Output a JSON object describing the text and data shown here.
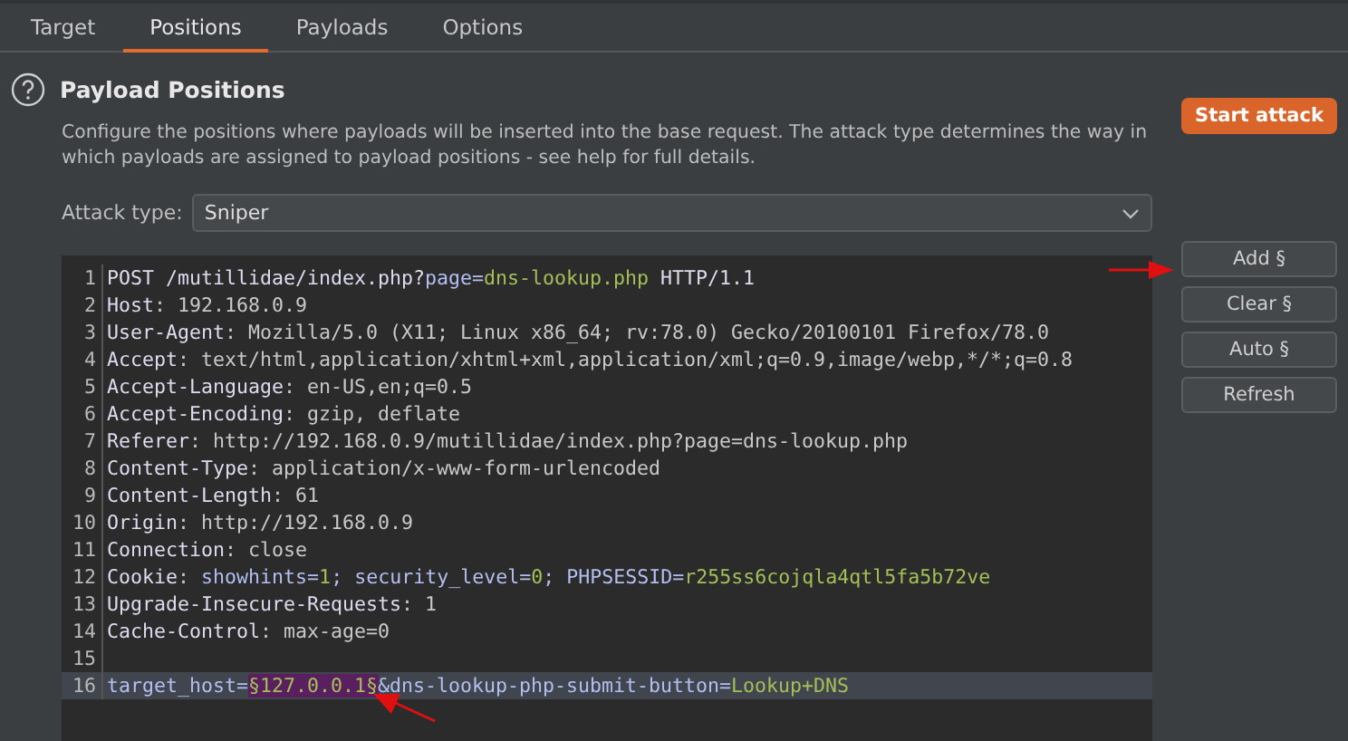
{
  "tabs": [
    {
      "label": "Target",
      "selected": false
    },
    {
      "label": "Positions",
      "selected": true
    },
    {
      "label": "Payloads",
      "selected": false
    },
    {
      "label": "Options",
      "selected": false
    }
  ],
  "section": {
    "title": "Payload Positions",
    "description": "Configure the positions where payloads will be inserted into the base request. The attack type determines the way in which payloads are assigned to payload positions - see help for full details.",
    "start_button": "Start attack"
  },
  "attack_type": {
    "label": "Attack type:",
    "value": "Sniper"
  },
  "editor": {
    "lines": [
      {
        "number": "1",
        "current": false,
        "segments": [
          {
            "kind": "name",
            "text": "POST /mutillidae/index.php?"
          },
          {
            "kind": "param",
            "text": "page="
          },
          {
            "kind": "value",
            "text": "dns-lookup.php"
          },
          {
            "kind": "name",
            "text": " HTTP/1.1"
          }
        ]
      },
      {
        "number": "2",
        "current": false,
        "segments": [
          {
            "kind": "name",
            "text": "Host"
          },
          {
            "kind": "text",
            "text": ": 192.168.0.9"
          }
        ]
      },
      {
        "number": "3",
        "current": false,
        "segments": [
          {
            "kind": "name",
            "text": "User-Agent"
          },
          {
            "kind": "text",
            "text": ": Mozilla/5.0 (X11; Linux x86_64; rv:78.0) Gecko/20100101 Firefox/78.0"
          }
        ]
      },
      {
        "number": "4",
        "current": false,
        "segments": [
          {
            "kind": "name",
            "text": "Accept"
          },
          {
            "kind": "text",
            "text": ": text/html,application/xhtml+xml,application/xml;q=0.9,image/webp,*/*;q=0.8"
          }
        ]
      },
      {
        "number": "5",
        "current": false,
        "segments": [
          {
            "kind": "name",
            "text": "Accept-Language"
          },
          {
            "kind": "text",
            "text": ": en-US,en;q=0.5"
          }
        ]
      },
      {
        "number": "6",
        "current": false,
        "segments": [
          {
            "kind": "name",
            "text": "Accept-Encoding"
          },
          {
            "kind": "text",
            "text": ": gzip, deflate"
          }
        ]
      },
      {
        "number": "7",
        "current": false,
        "segments": [
          {
            "kind": "name",
            "text": "Referer"
          },
          {
            "kind": "text",
            "text": ": http://192.168.0.9/mutillidae/index.php?page=dns-lookup.php"
          }
        ]
      },
      {
        "number": "8",
        "current": false,
        "segments": [
          {
            "kind": "name",
            "text": "Content-Type"
          },
          {
            "kind": "text",
            "text": ": application/x-www-form-urlencoded"
          }
        ]
      },
      {
        "number": "9",
        "current": false,
        "segments": [
          {
            "kind": "name",
            "text": "Content-Length"
          },
          {
            "kind": "text",
            "text": ": 61"
          }
        ]
      },
      {
        "number": "10",
        "current": false,
        "segments": [
          {
            "kind": "name",
            "text": "Origin"
          },
          {
            "kind": "text",
            "text": ": http://192.168.0.9"
          }
        ]
      },
      {
        "number": "11",
        "current": false,
        "segments": [
          {
            "kind": "name",
            "text": "Connection"
          },
          {
            "kind": "text",
            "text": ": close"
          }
        ]
      },
      {
        "number": "12",
        "current": false,
        "segments": [
          {
            "kind": "name",
            "text": "Cookie"
          },
          {
            "kind": "text",
            "text": ": "
          },
          {
            "kind": "param",
            "text": "showhints="
          },
          {
            "kind": "value",
            "text": "1"
          },
          {
            "kind": "param",
            "text": "; security_level="
          },
          {
            "kind": "value",
            "text": "0"
          },
          {
            "kind": "param",
            "text": "; PHPSESSID="
          },
          {
            "kind": "value",
            "text": "r255ss6cojqla4qtl5fa5b72ve"
          }
        ]
      },
      {
        "number": "13",
        "current": false,
        "segments": [
          {
            "kind": "name",
            "text": "Upgrade-Insecure-Requests"
          },
          {
            "kind": "text",
            "text": ": 1"
          }
        ]
      },
      {
        "number": "14",
        "current": false,
        "segments": [
          {
            "kind": "name",
            "text": "Cache-Control"
          },
          {
            "kind": "text",
            "text": ": max-age=0"
          }
        ]
      },
      {
        "number": "15",
        "current": false
      },
      {
        "number": "16",
        "current": true,
        "segments": [
          {
            "kind": "param",
            "text": "target_host="
          },
          {
            "kind": "payload",
            "text": "§127.0.0.1§"
          },
          {
            "kind": "param",
            "text": "&dns-lookup-php-submit-button="
          },
          {
            "kind": "value",
            "text": "Lookup+DNS"
          }
        ]
      }
    ]
  },
  "side_buttons": [
    "Add §",
    "Clear §",
    "Auto §",
    "Refresh"
  ]
}
